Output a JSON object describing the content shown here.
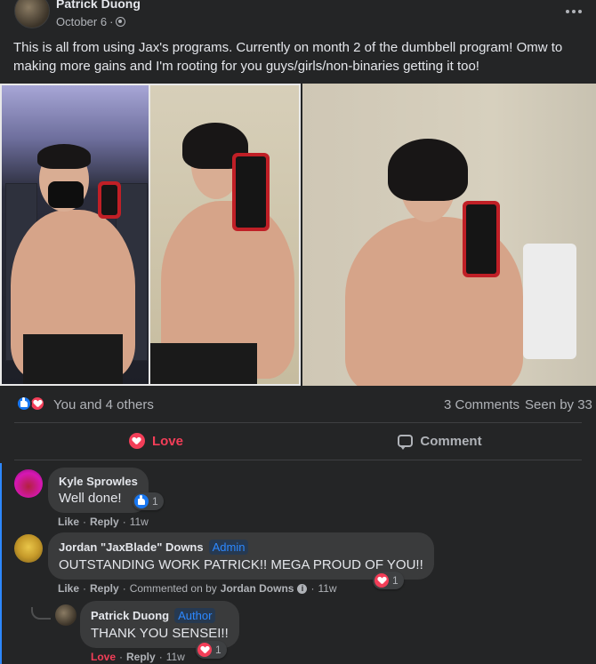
{
  "post": {
    "author": "Patrick Duong",
    "date": "October 6",
    "separator": "·",
    "text": "This is all from using Jax's programs. Currently on month 2 of the dumbbell program! Omw to making more gains and I'm rooting for you guys/girls/non-binaries getting it too!"
  },
  "stats": {
    "reactions_text": "You and 4 others",
    "comments": "3 Comments",
    "seen": "Seen by 33"
  },
  "actions": {
    "love_label": "Love",
    "comment_label": "Comment"
  },
  "comments": [
    {
      "name": "Kyle Sprowles",
      "text": "Well done!",
      "reaction_count": "1",
      "like_label": "Like",
      "reply_label": "Reply",
      "time": "11w"
    },
    {
      "name": "Jordan \"JaxBlade\" Downs",
      "badge": "Admin",
      "text": "OUTSTANDING WORK PATRICK!! MEGA PROUD OF YOU!!",
      "reaction_count": "1",
      "like_label": "Like",
      "reply_label": "Reply",
      "commented_on": "Commented on by",
      "commented_by": "Jordan Downs",
      "time": "11w"
    },
    {
      "name": "Patrick Duong",
      "badge": "Author",
      "text": "THANK YOU SENSEI!!",
      "reaction_count": "1",
      "love_label": "Love",
      "reply_label": "Reply",
      "time": "11w"
    }
  ],
  "colors": {
    "background": "#242526",
    "bubble": "#3a3b3c",
    "primary_text": "#e4e6eb",
    "secondary_text": "#b0b3b8",
    "love": "#f33e58",
    "like": "#1877f2",
    "accent": "#2d88ff"
  }
}
